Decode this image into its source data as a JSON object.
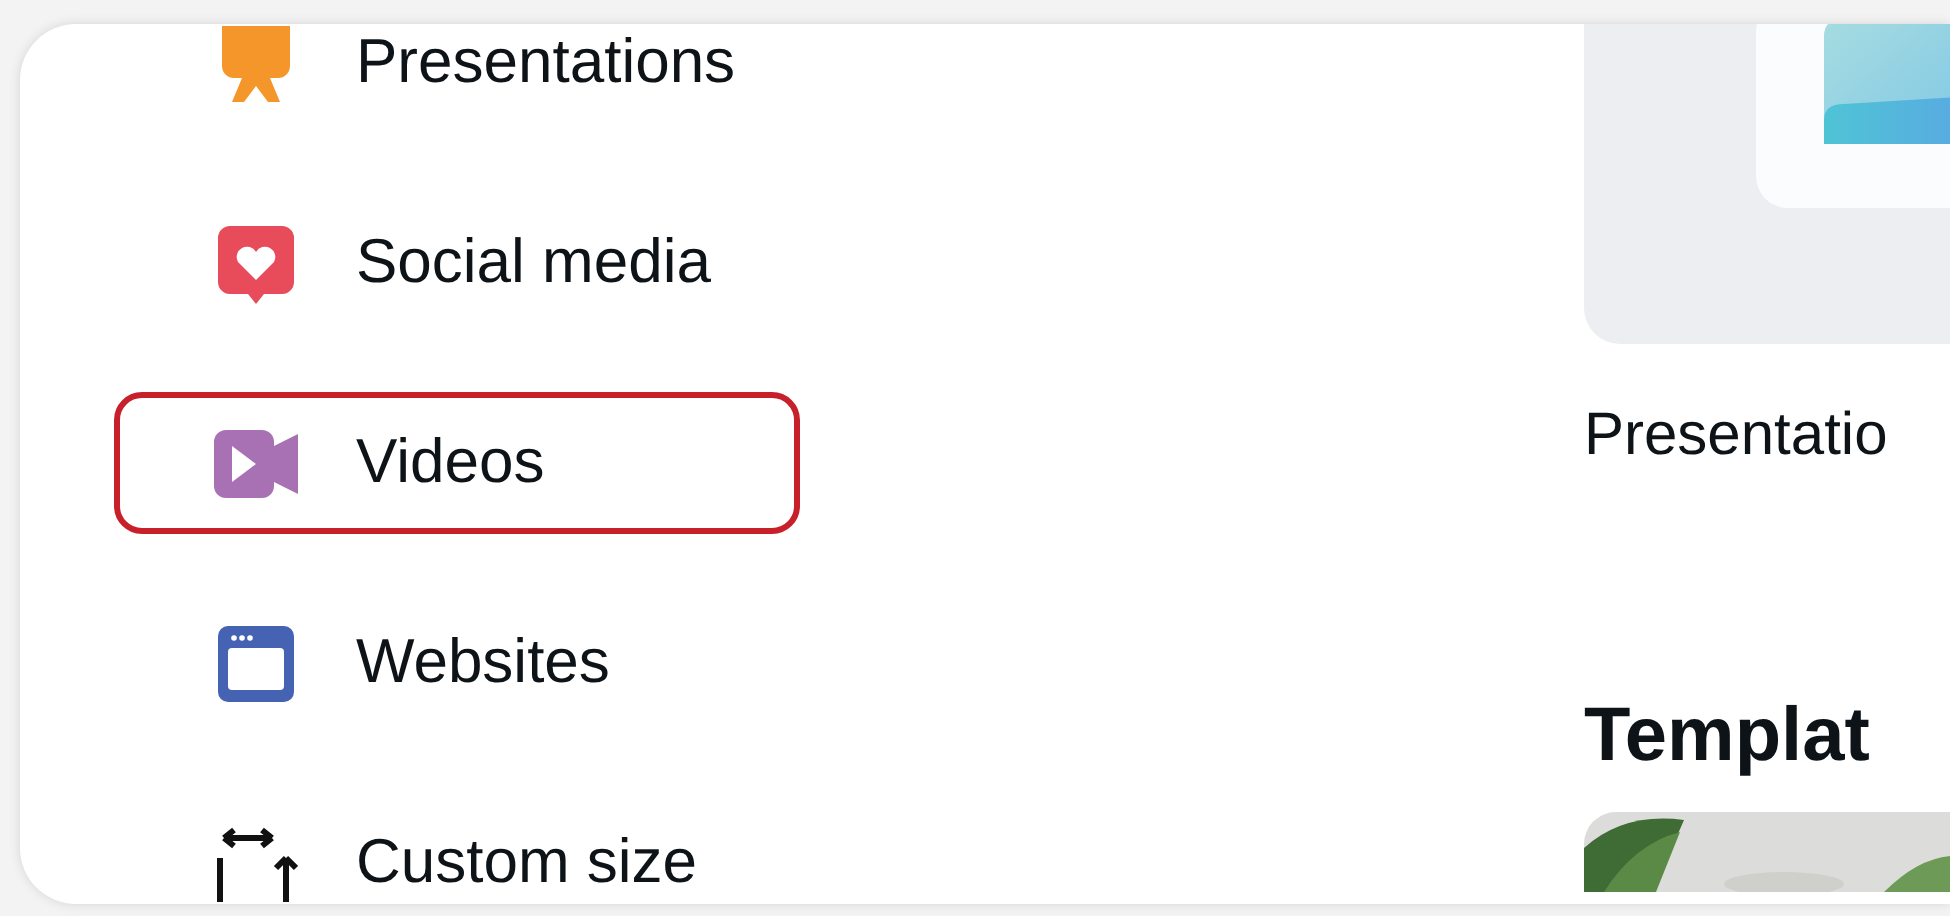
{
  "menu": {
    "items": [
      {
        "label": "Presentations",
        "kind": "presentation",
        "selected": false
      },
      {
        "label": "Social media",
        "kind": "social",
        "selected": false
      },
      {
        "label": "Videos",
        "kind": "video",
        "selected": true
      },
      {
        "label": "Websites",
        "kind": "website",
        "selected": false
      },
      {
        "label": "Custom size",
        "kind": "custom",
        "selected": false
      }
    ]
  },
  "featured": {
    "caption": "Presentatio"
  },
  "templates": {
    "heading": "Templat"
  }
}
